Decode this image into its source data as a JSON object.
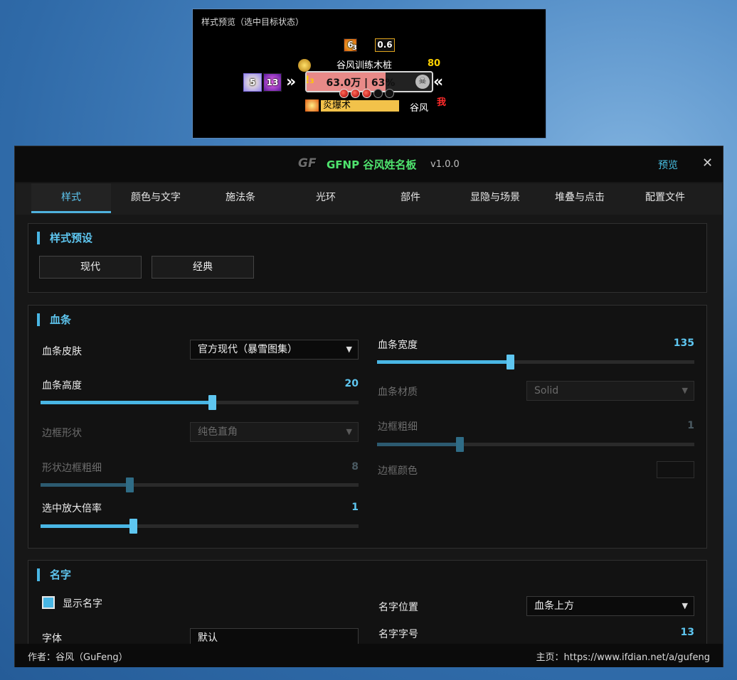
{
  "preview": {
    "title": "样式预览（选中目标状态）",
    "buffs_top": [
      {
        "value": "6",
        "stack": "3"
      },
      {
        "value": "0.6"
      }
    ],
    "buffs_left": [
      {
        "value": "5"
      },
      {
        "value": "13"
      }
    ],
    "unit_name": "谷风训练木桩",
    "unit_level": "80",
    "health_text": "63.0万 | 63%",
    "health_percent": 63,
    "warning_glyph": "!",
    "warning_stack": "3",
    "combo_points_filled": 3,
    "combo_points_total": 5,
    "cast_spell": "炎爆术",
    "cast_target": "谷风",
    "me_tag": "我",
    "arrow_left": "»",
    "arrow_right": "«",
    "skull_glyph": "☠"
  },
  "window": {
    "logo": "GF",
    "title": "GFNP 谷风姓名板",
    "version": "v1.0.0",
    "preview_label": "预览",
    "close_glyph": "✕"
  },
  "tabs": [
    "样式",
    "颜色与文字",
    "施法条",
    "光环",
    "部件",
    "显隐与场景",
    "堆叠与点击",
    "配置文件"
  ],
  "active_tab": "样式",
  "style_preset": {
    "title": "样式预设",
    "buttons": [
      "现代",
      "经典"
    ]
  },
  "healthbar": {
    "title": "血条",
    "skin_label": "血条皮肤",
    "skin_value": "官方现代（暴雪图集）",
    "height_label": "血条高度",
    "height_value": "20",
    "height_fraction": 0.54,
    "border_shape_label": "边框形状",
    "border_shape_value": "纯色直角",
    "shape_border_thickness_label": "形状边框粗细",
    "shape_border_thickness_value": "8",
    "shape_border_thickness_fraction": 0.28,
    "select_scale_label": "选中放大倍率",
    "select_scale_value": "1",
    "select_scale_fraction": 0.29,
    "width_label": "血条宽度",
    "width_value": "135",
    "width_fraction": 0.42,
    "texture_label": "血条材质",
    "texture_value": "Solid",
    "border_thickness_label": "边框粗细",
    "border_thickness_value": "1",
    "border_thickness_fraction": 0.26,
    "border_color_label": "边框颜色",
    "dropdown_arrow": "▼"
  },
  "name": {
    "title": "名字",
    "show_name_label": "显示名字",
    "show_name_checked": true,
    "position_label": "名字位置",
    "position_value": "血条上方",
    "font_size_label": "名字字号",
    "font_size_value": "13",
    "partial_label": "字体",
    "partial_dropdown": "默认"
  },
  "footer": {
    "author": "作者：谷风（GuFeng）",
    "home": "主页：https://www.ifdian.net/a/gufeng"
  },
  "colors": {
    "accent": "#49b6e4",
    "title_green": "#4fe46e",
    "level_yellow": "#ffd200",
    "me_red": "#ff2b2b"
  }
}
